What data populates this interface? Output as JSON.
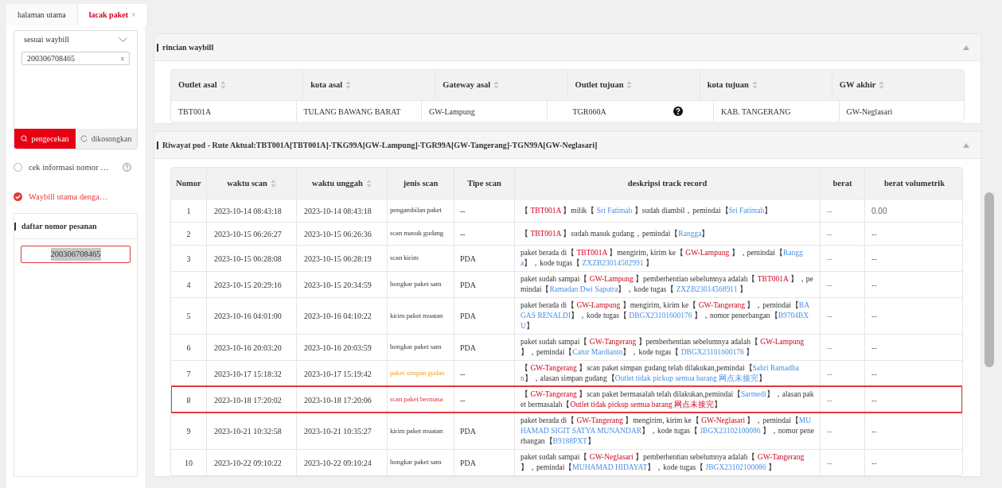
{
  "tabs": [
    {
      "label": "halaman utama",
      "selected": false,
      "closable": false
    },
    {
      "label": "lacak paket",
      "selected": true,
      "closable": true,
      "close": "×"
    }
  ],
  "sidebar": {
    "mode_select": "sesuai waybill",
    "waybill_input": "200306708465",
    "clear": "x",
    "buttons": [
      {
        "label": "pengecekan",
        "kind": "primary"
      },
      {
        "label": "dikosongkan",
        "kind": "secondary"
      }
    ],
    "options": [
      {
        "label": "cek informasi nomor …",
        "selected": false,
        "help": true
      },
      {
        "label": "Waybill utama denga…",
        "selected": true,
        "help": false
      }
    ],
    "order_list": {
      "title": "daftar nomor pesanan",
      "items": [
        {
          "label": "200306708465",
          "selected": true
        }
      ]
    }
  },
  "waybill_details": {
    "title": "rincian waybill",
    "expanded": true,
    "columns": [
      {
        "label": "Outlet asal",
        "sortable": true
      },
      {
        "label": "kota asal",
        "sortable": true
      },
      {
        "label": "Gateway asal",
        "sortable": true
      },
      {
        "label": "Outlet tujuan",
        "sortable": true
      },
      {
        "label": "kota tujuan",
        "sortable": true
      },
      {
        "label": "GW akhir",
        "sortable": true
      }
    ],
    "row": [
      {
        "text": "TBT001A"
      },
      {
        "text": "TULANG BAWANG BARAT"
      },
      {
        "text": "GW-Lampung"
      },
      {
        "text": "TGR060A",
        "help": true
      },
      {
        "text": "KAB. TANGERANG"
      },
      {
        "text": "GW-Neglasari"
      }
    ]
  },
  "pod_history": {
    "title": "Riwayat pod - Rute Aktual:TBT001A[TBT001A]-TKG99A[GW-Lampung]-TGR99A[GW-Tangerang]-TGN99A[GW-Neglasari]",
    "expanded": true,
    "columns": [
      {
        "label": "Nomor",
        "sortable": false
      },
      {
        "label": "waktu scan",
        "sortable": true
      },
      {
        "label": "waktu unggah",
        "sortable": true
      },
      {
        "label": "jenis scan",
        "sortable": false
      },
      {
        "label": "Tipe scan",
        "sortable": false
      },
      {
        "label": "deskripsi track record",
        "sortable": false
      },
      {
        "label": "berat",
        "sortable": false
      },
      {
        "label": "berat volumetrik",
        "sortable": false
      }
    ],
    "rows": [
      {
        "nomor": "1",
        "waktu_scan": "2023-10-14 08:43:18",
        "waktu_unggah": "2023-10-14 08:43:18",
        "jenis_scan": "pengambilan paket",
        "kind": "normal",
        "tipe_scan": "--",
        "marked": false,
        "berat": "--",
        "berat_volumetrik": "0.00",
        "deskripsi": [
          {
            "kind": "text",
            "text": "【 "
          },
          {
            "kind": "place",
            "text": "TBT001A"
          },
          {
            "kind": "text",
            "text": " 】milik【 "
          },
          {
            "kind": "person",
            "text": "Sri Fatimah"
          },
          {
            "kind": "text",
            "text": " 】sudah diambil，pemindai【"
          },
          {
            "kind": "person",
            "text": "Sri Fatimah"
          },
          {
            "kind": "text",
            "text": "】"
          }
        ]
      },
      {
        "nomor": "2",
        "waktu_scan": "2023-10-15 06:26:27",
        "waktu_unggah": "2023-10-15 06:26:36",
        "jenis_scan": "scan masuk gudang",
        "kind": "normal",
        "tipe_scan": "--",
        "marked": false,
        "berat": "--",
        "berat_volumetrik": "--",
        "deskripsi": [
          {
            "kind": "text",
            "text": "【 "
          },
          {
            "kind": "place",
            "text": "TBT001A"
          },
          {
            "kind": "text",
            "text": " 】sudah masuk gudang，pemindai【"
          },
          {
            "kind": "person",
            "text": "Rangga"
          },
          {
            "kind": "text",
            "text": "】"
          }
        ]
      },
      {
        "nomor": "3",
        "waktu_scan": "2023-10-15 06:28:08",
        "waktu_unggah": "2023-10-15 06:28:19",
        "jenis_scan": "scan kirim",
        "kind": "normal",
        "tipe_scan": "PDA",
        "marked": false,
        "berat": "--",
        "berat_volumetrik": "--",
        "deskripsi": [
          {
            "kind": "text",
            "text": "paket berada di【 "
          },
          {
            "kind": "place",
            "text": "TBT001A"
          },
          {
            "kind": "text",
            "text": " 】mengirim, kirim ke【 "
          },
          {
            "kind": "place",
            "text": "GW-Lampung"
          },
          {
            "kind": "text",
            "text": " 】，pemindai【"
          },
          {
            "kind": "person",
            "text": "Rangga"
          },
          {
            "kind": "text",
            "text": "】，kode tugas【 "
          },
          {
            "kind": "person",
            "text": "ZXZB23014582991"
          },
          {
            "kind": "text",
            "text": " 】"
          }
        ]
      },
      {
        "nomor": "4",
        "waktu_scan": "2023-10-15 20:29:16",
        "waktu_unggah": "2023-10-15 20:34:59",
        "jenis_scan": "bongkar paket sam",
        "kind": "normal",
        "tipe_scan": "PDA",
        "marked": false,
        "berat": "--",
        "berat_volumetrik": "--",
        "deskripsi": [
          {
            "kind": "text",
            "text": "paket sudah sampai【 "
          },
          {
            "kind": "place",
            "text": "GW-Lampung"
          },
          {
            "kind": "text",
            "text": " 】pemberhentian sebelumnya adalah【 "
          },
          {
            "kind": "place",
            "text": "TBT001A"
          },
          {
            "kind": "text",
            "text": " 】，pemindai【"
          },
          {
            "kind": "person",
            "text": "Ramadan Dwi Saputra"
          },
          {
            "kind": "text",
            "text": "】，kode tugas【 "
          },
          {
            "kind": "person",
            "text": "ZXZB23014568911"
          },
          {
            "kind": "text",
            "text": " 】"
          }
        ]
      },
      {
        "nomor": "5",
        "waktu_scan": "2023-10-16 04:01:00",
        "waktu_unggah": "2023-10-16 04:10:22",
        "jenis_scan": "kirim paket muatan",
        "kind": "normal",
        "tipe_scan": "PDA",
        "marked": false,
        "berat": "--",
        "berat_volumetrik": "--",
        "deskripsi": [
          {
            "kind": "text",
            "text": "paket berada di【 "
          },
          {
            "kind": "place",
            "text": "GW-Lampung"
          },
          {
            "kind": "text",
            "text": " 】mengirim, kirim ke【 "
          },
          {
            "kind": "place",
            "text": "GW-Tangerang"
          },
          {
            "kind": "text",
            "text": " 】，pemindai【"
          },
          {
            "kind": "person",
            "text": "BAGAS RENALDI"
          },
          {
            "kind": "text",
            "text": "】，kode tugas【 "
          },
          {
            "kind": "person",
            "text": "DBGX23101600176"
          },
          {
            "kind": "text",
            "text": " 】，nomor penerbangan【"
          },
          {
            "kind": "person",
            "text": "B9704BXU"
          },
          {
            "kind": "text",
            "text": "】"
          }
        ]
      },
      {
        "nomor": "6",
        "waktu_scan": "2023-10-16 20:03:20",
        "waktu_unggah": "2023-10-16 20:03:59",
        "jenis_scan": "bongkar paket sam",
        "kind": "normal",
        "tipe_scan": "PDA",
        "marked": false,
        "berat": "--",
        "berat_volumetrik": "--",
        "deskripsi": [
          {
            "kind": "text",
            "text": "paket sudah sampai【 "
          },
          {
            "kind": "place",
            "text": "GW-Tangerang"
          },
          {
            "kind": "text",
            "text": " 】pemberhentian sebelumnya adalah【 "
          },
          {
            "kind": "place",
            "text": "GW-Lampung"
          },
          {
            "kind": "text",
            "text": " 】，pemindai【"
          },
          {
            "kind": "person",
            "text": "Catur Mardianto"
          },
          {
            "kind": "text",
            "text": "】，kode tugas【 "
          },
          {
            "kind": "person",
            "text": "DBGX23101600176"
          },
          {
            "kind": "text",
            "text": " 】"
          }
        ]
      },
      {
        "nomor": "7",
        "waktu_scan": "2023-10-17 15:18:32",
        "waktu_unggah": "2023-10-17 15:19:42",
        "jenis_scan": "paket simpan gudan",
        "kind": "warning",
        "tipe_scan": "--",
        "marked": false,
        "berat": "--",
        "berat_volumetrik": "--",
        "deskripsi": [
          {
            "kind": "text",
            "text": "【 "
          },
          {
            "kind": "place",
            "text": "GW-Tangerang"
          },
          {
            "kind": "text",
            "text": " 】scan paket simpan gudang telah dilakukan,pemindai【"
          },
          {
            "kind": "person",
            "text": "Sahri Ramadhan"
          },
          {
            "kind": "text",
            "text": "】，alasan simpan gudang【"
          },
          {
            "kind": "person",
            "text": "Outlet tidak pickup semua barang 网点未接完"
          },
          {
            "kind": "text",
            "text": "】"
          }
        ]
      },
      {
        "nomor": "8",
        "waktu_scan": "2023-10-18 17:20:02",
        "waktu_unggah": "2023-10-18 17:20:06",
        "jenis_scan": "scan paket bermasa",
        "kind": "error",
        "tipe_scan": "--",
        "marked": true,
        "berat": "--",
        "berat_volumetrik": "--",
        "deskripsi": [
          {
            "kind": "text",
            "text": "【 "
          },
          {
            "kind": "place",
            "text": "GW-Tangerang"
          },
          {
            "kind": "text",
            "text": " 】scan paket bermasalah telah dilakukan,pemindai【"
          },
          {
            "kind": "person",
            "text": "Sarmedi"
          },
          {
            "kind": "text",
            "text": "】，alasan paket bermasalah【"
          },
          {
            "kind": "place",
            "text": "Outlet tidak pickup semua barang 网点未接完"
          },
          {
            "kind": "text",
            "text": "】"
          }
        ]
      },
      {
        "nomor": "9",
        "waktu_scan": "2023-10-21 10:32:58",
        "waktu_unggah": "2023-10-21 10:35:27",
        "jenis_scan": "kirim paket muatan",
        "kind": "normal",
        "tipe_scan": "PDA",
        "marked": false,
        "berat": "--",
        "berat_volumetrik": "--",
        "deskripsi": [
          {
            "kind": "text",
            "text": "paket berada di【 "
          },
          {
            "kind": "place",
            "text": "GW-Tangerang"
          },
          {
            "kind": "text",
            "text": " 】mengirim, kirim ke【 "
          },
          {
            "kind": "place",
            "text": "GW-Neglasari"
          },
          {
            "kind": "text",
            "text": " 】，pemindai【"
          },
          {
            "kind": "person",
            "text": "MUHAMAD SIGIT SATYA MUNANDAR"
          },
          {
            "kind": "text",
            "text": "】，kode tugas【 "
          },
          {
            "kind": "person",
            "text": "JBGX23102100086"
          },
          {
            "kind": "text",
            "text": " 】，nomor penerbangan【"
          },
          {
            "kind": "person",
            "text": "B9188PXT"
          },
          {
            "kind": "text",
            "text": "】"
          }
        ]
      },
      {
        "nomor": "10",
        "waktu_scan": "2023-10-22 09:10:22",
        "waktu_unggah": "2023-10-22 09:10:24",
        "jenis_scan": "bongkar paket sam",
        "kind": "normal",
        "tipe_scan": "PDA",
        "marked": false,
        "berat": "--",
        "berat_volumetrik": "--",
        "deskripsi": [
          {
            "kind": "text",
            "text": "paket sudah sampai【 "
          },
          {
            "kind": "place",
            "text": "GW-Neglasari"
          },
          {
            "kind": "text",
            "text": " 】pemberhentian sebelumnya adalah【 "
          },
          {
            "kind": "place",
            "text": "GW-Tangerang"
          },
          {
            "kind": "text",
            "text": " 】，pemindai【"
          },
          {
            "kind": "person",
            "text": "MUHAMAD HIDAYAT"
          },
          {
            "kind": "text",
            "text": "】，kode tugas【 "
          },
          {
            "kind": "person",
            "text": "JBGX23102100086"
          },
          {
            "kind": "text",
            "text": " 】"
          }
        ]
      }
    ]
  }
}
